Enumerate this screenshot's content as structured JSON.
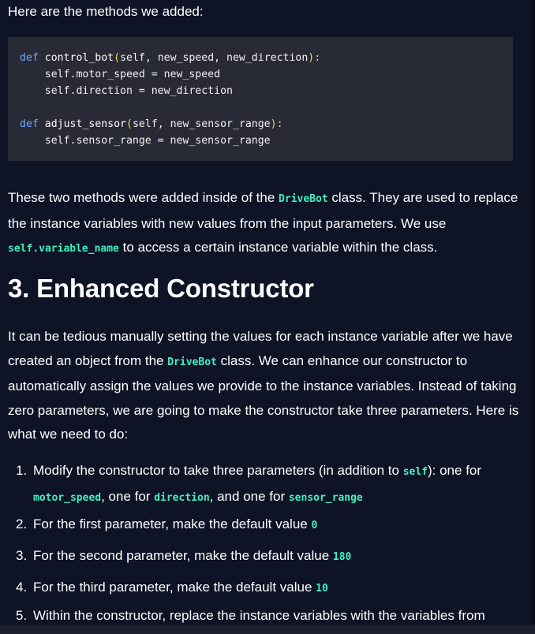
{
  "intro": "Here are the methods we added:",
  "code": {
    "l1_kw": "def",
    "l1_fn": "control_bot",
    "l1_open": "(",
    "l1_params": "self, new_speed, new_direction",
    "l1_close": "):",
    "l2": "    self.motor_speed = new_speed",
    "l3": "    self.direction = new_direction",
    "l4_kw": "def",
    "l4_fn": "adjust_sensor",
    "l4_open": "(",
    "l4_params": "self, new_sensor_range",
    "l4_close": "):",
    "l5": "    self.sensor_range = new_sensor_range"
  },
  "para1": {
    "t1": "These two methods were added inside of the ",
    "c1": "DriveBot",
    "t2": " class. They are used to replace the instance variables with new values from the input parameters. We use ",
    "c2": "self.variable_name",
    "t3": " to access a certain instance variable within the class."
  },
  "heading": "3. Enhanced Constructor",
  "para2": {
    "t1": "It can be tedious manually setting the values for each instance variable after we have created an object from the ",
    "c1": "DriveBot",
    "t2": " class. We can enhance our constructor to automatically assign the values we provide to the instance variables. Instead of taking zero parameters, we are going to make the constructor take three parameters. Here is what we need to do:"
  },
  "steps": [
    {
      "num": "1.",
      "t1": "Modify the constructor to take three parameters (in addition to ",
      "c1": "self",
      "t2": "): one for ",
      "c2": "motor_speed",
      "t3": ", one for ",
      "c3": "direction",
      "t4": ", and one for ",
      "c4": "sensor_range"
    },
    {
      "num": "2.",
      "t1": "For the first parameter, make the default value ",
      "c1": "0"
    },
    {
      "num": "3.",
      "t1": "For the second parameter, make the default value ",
      "c1": "180"
    },
    {
      "num": "4.",
      "t1": "For the third parameter, make the default value ",
      "c1": "10"
    },
    {
      "num": "5.",
      "t1": "Within the constructor, replace the instance variables with the variables from"
    }
  ],
  "colors": {
    "background": "#0f1326",
    "code_background": "#282a36",
    "inline_code": "#3ef0c2",
    "keyword": "#6fa5ff",
    "punctuation": "#f6d85a"
  }
}
